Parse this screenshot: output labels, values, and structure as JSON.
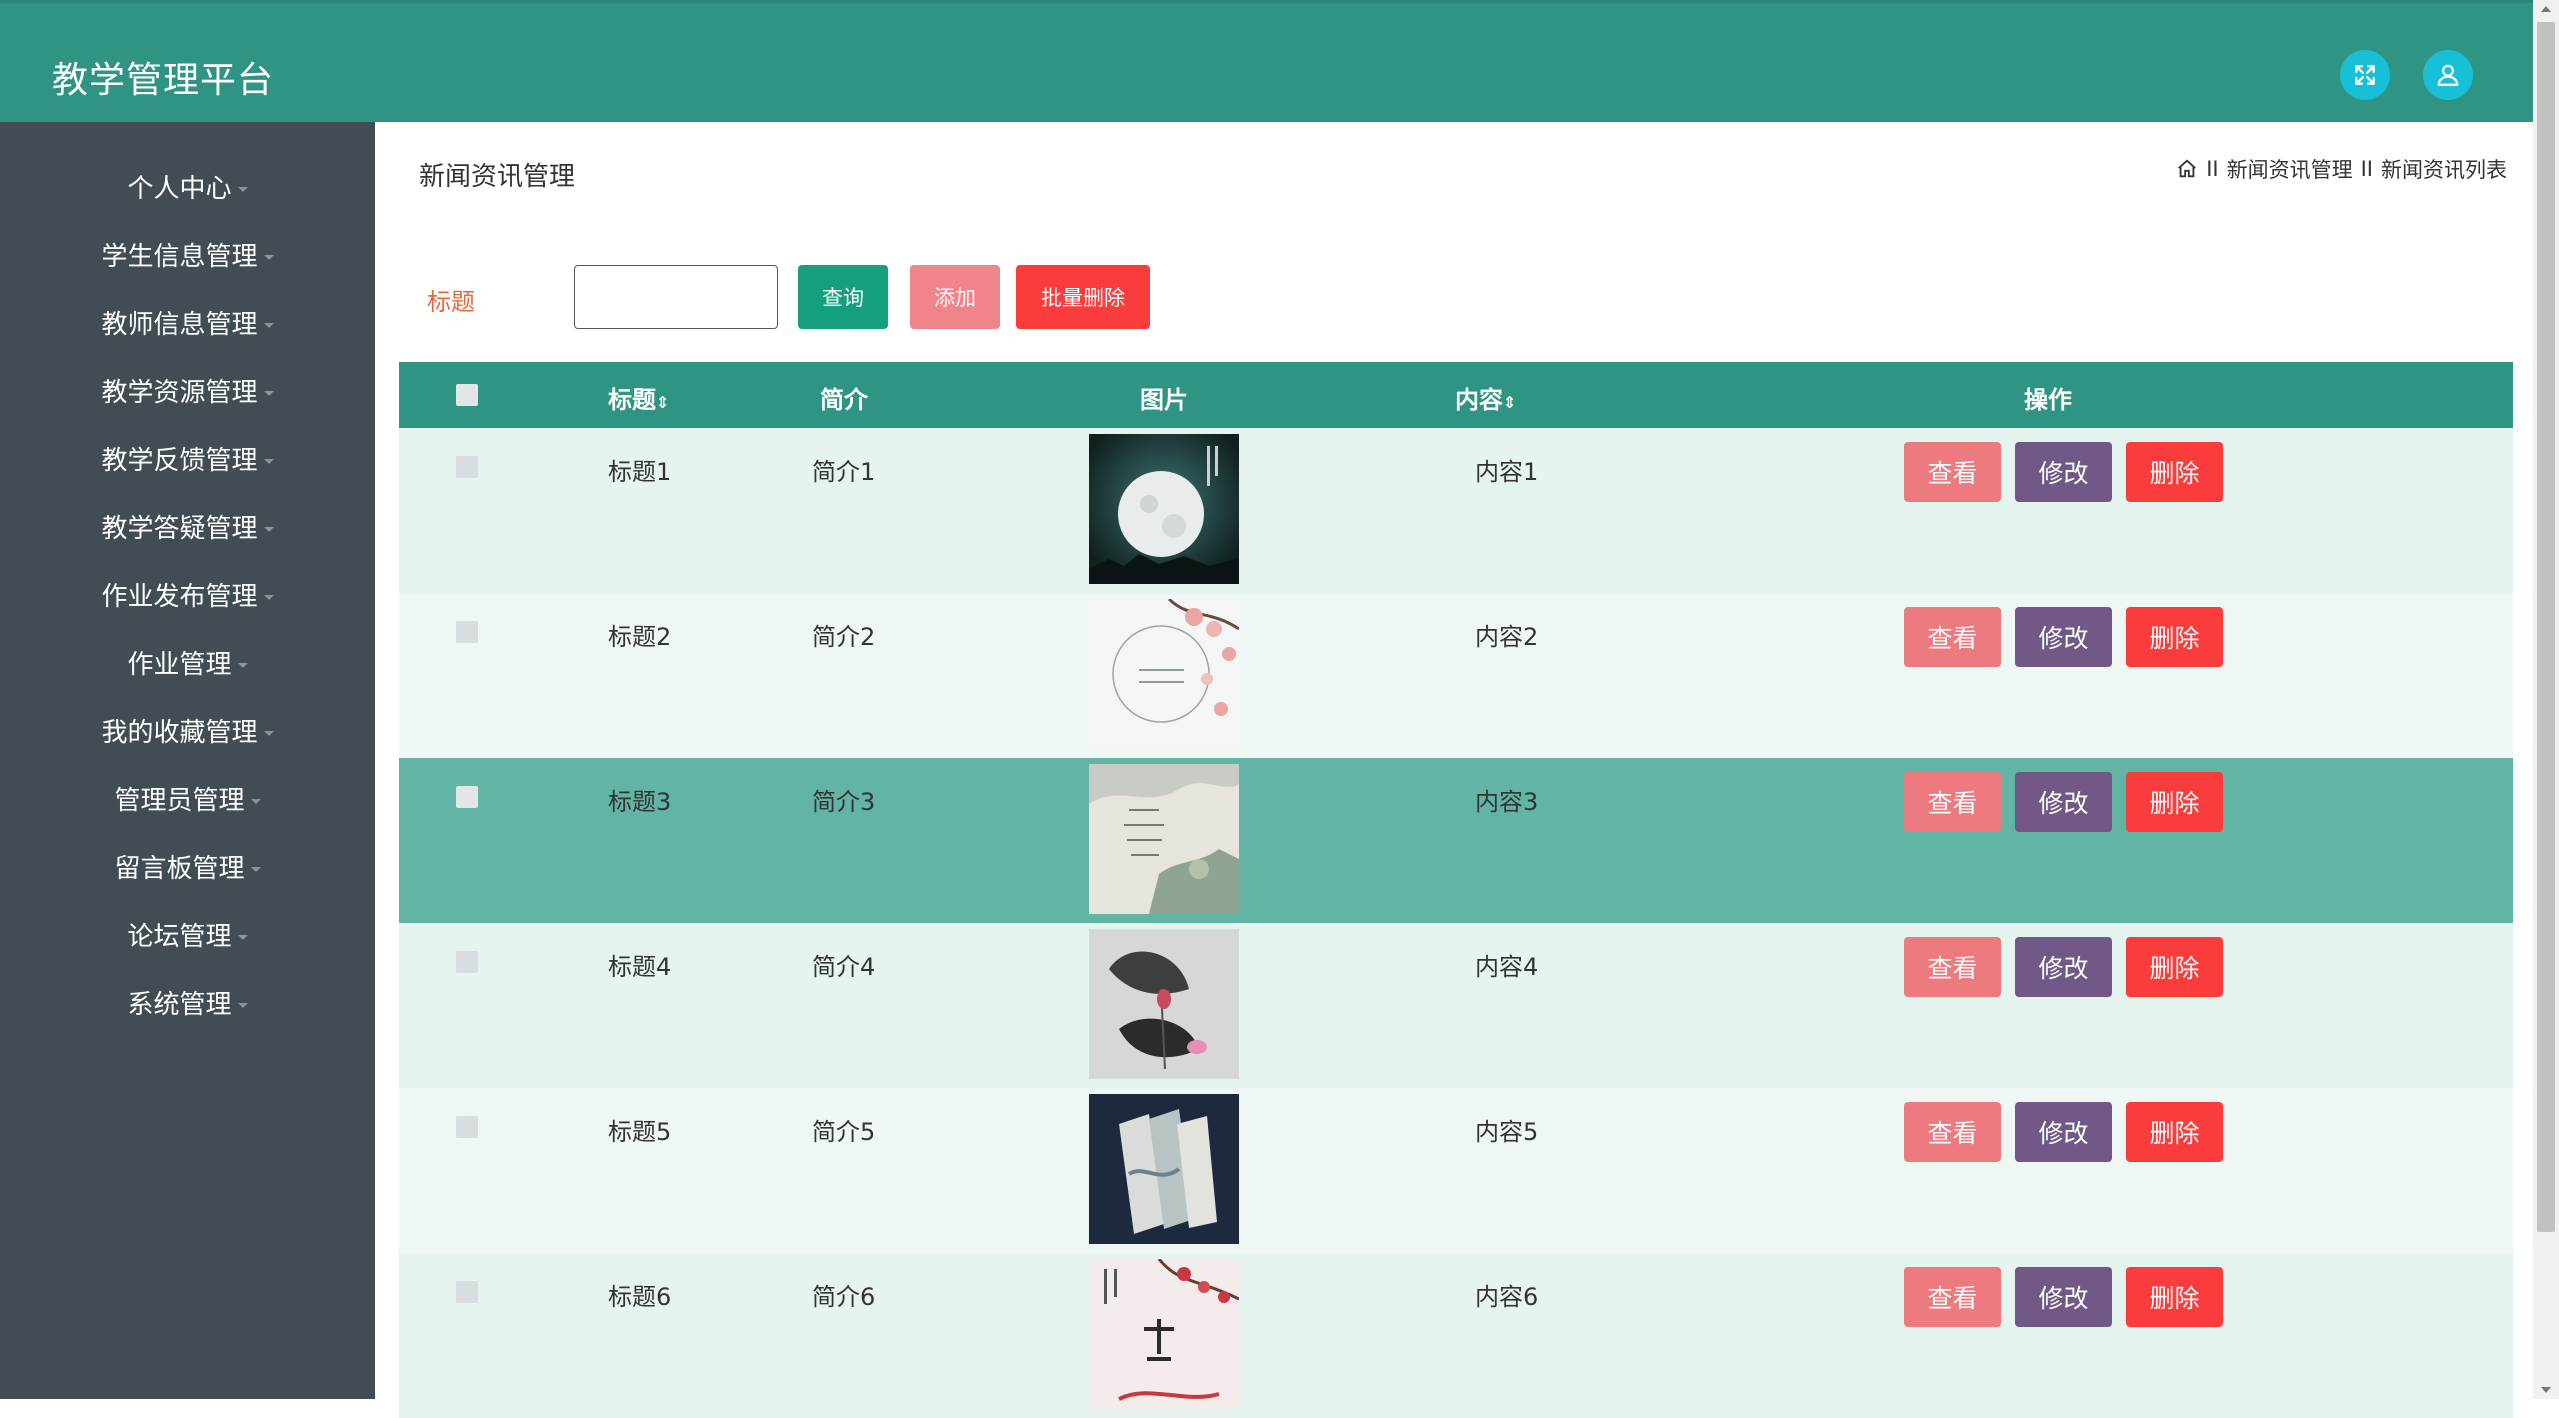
{
  "header": {
    "brand": "教学管理平台",
    "fullscreen_icon": "fullscreen-icon",
    "user_icon": "user-icon"
  },
  "colors": {
    "accent": "#2f9484",
    "sidebar": "#424c53",
    "view": "#ec7a7f",
    "edit": "#725886",
    "delete": "#fb3c3c",
    "query": "#15a07d",
    "add": "#ef858b",
    "batch_delete": "#fb3c3c"
  },
  "sidebar": {
    "items": [
      {
        "label": "个人中心"
      },
      {
        "label": "学生信息管理"
      },
      {
        "label": "教师信息管理"
      },
      {
        "label": "教学资源管理"
      },
      {
        "label": "教学反馈管理"
      },
      {
        "label": "教学答疑管理"
      },
      {
        "label": "作业发布管理"
      },
      {
        "label": "作业管理"
      },
      {
        "label": "我的收藏管理"
      },
      {
        "label": "管理员管理"
      },
      {
        "label": "留言板管理"
      },
      {
        "label": "论坛管理"
      },
      {
        "label": "系统管理"
      }
    ]
  },
  "page": {
    "title": "新闻资讯管理",
    "breadcrumb": {
      "sep": "II",
      "level1": "新闻资讯管理",
      "level2": "新闻资讯列表"
    }
  },
  "search": {
    "label": "标题",
    "value": "",
    "query": "查询",
    "add": "添加",
    "batch_delete": "批量删除"
  },
  "table": {
    "headers": {
      "title": "标题",
      "intro": "简介",
      "image": "图片",
      "content": "内容",
      "actions": "操作"
    },
    "rows": [
      {
        "title": "标题1",
        "intro": "简介1",
        "content": "内容1"
      },
      {
        "title": "标题2",
        "intro": "简介2",
        "content": "内容2"
      },
      {
        "title": "标题3",
        "intro": "简介3",
        "content": "内容3"
      },
      {
        "title": "标题4",
        "intro": "简介4",
        "content": "内容4"
      },
      {
        "title": "标题5",
        "intro": "简介5",
        "content": "内容5"
      },
      {
        "title": "标题6",
        "intro": "简介6",
        "content": "内容6"
      }
    ],
    "actions": {
      "view": "查看",
      "edit": "修改",
      "delete": "删除"
    }
  }
}
